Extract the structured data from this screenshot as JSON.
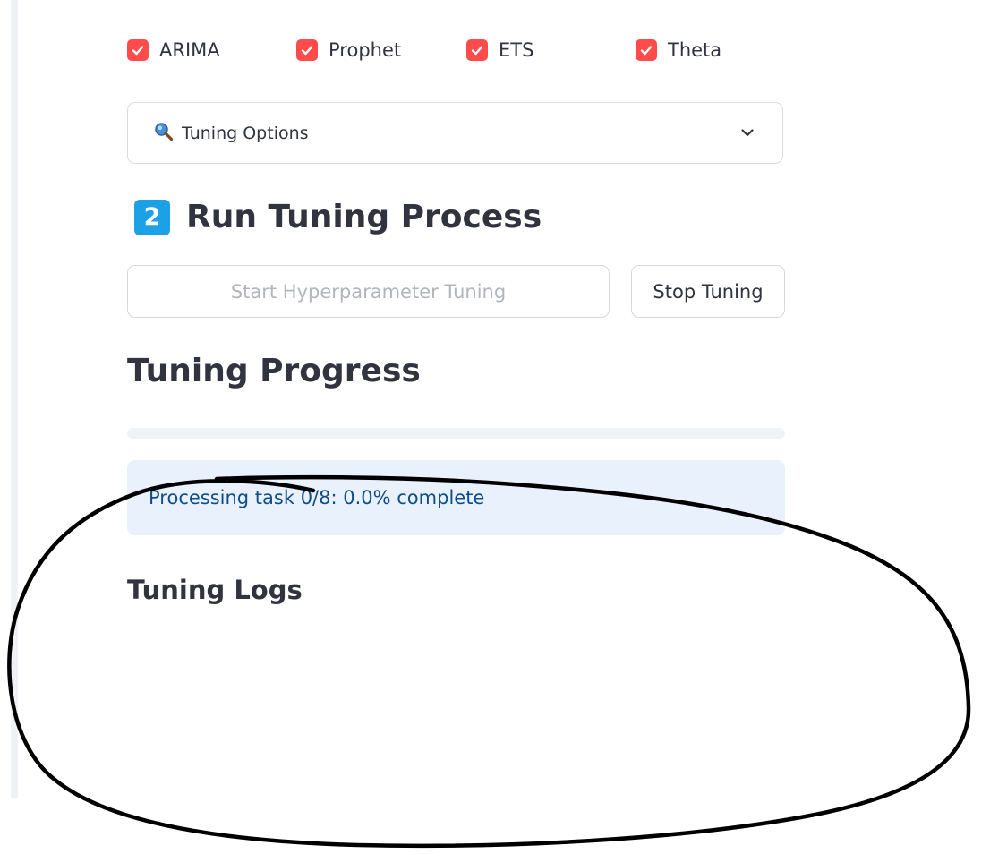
{
  "models": [
    {
      "label": "ARIMA",
      "checked": true
    },
    {
      "label": "Prophet",
      "checked": true
    },
    {
      "label": "ETS",
      "checked": true
    },
    {
      "label": "Theta",
      "checked": true
    }
  ],
  "expander": {
    "icon": "magnifier-icon",
    "label": "Tuning Options",
    "expanded": false
  },
  "section": {
    "number": "2",
    "title": "Run Tuning Process"
  },
  "buttons": {
    "start_label": "Start Hyperparameter Tuning",
    "start_disabled": true,
    "stop_label": "Stop Tuning"
  },
  "progress": {
    "title": "Tuning Progress",
    "fraction": 0.0,
    "status_text": "Processing task 0/8: 0.0% complete"
  },
  "logs": {
    "title": "Tuning Logs"
  },
  "colors": {
    "accent": "#ff4b4b",
    "badge": "#1ba1e6",
    "info_bg": "#e8f1fc",
    "info_text": "#0f4c8a",
    "text": "#31333f"
  }
}
